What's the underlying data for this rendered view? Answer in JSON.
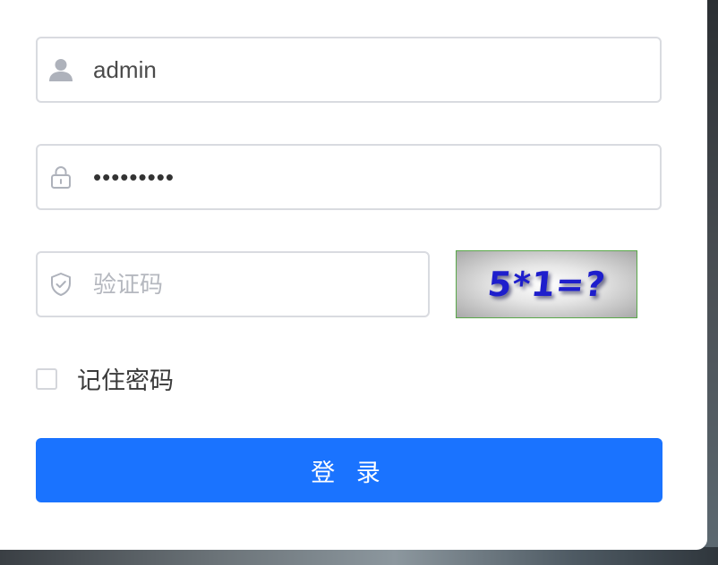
{
  "login": {
    "username": {
      "value": "admin",
      "icon": "user-icon"
    },
    "password": {
      "value": "admin1234",
      "icon": "lock-icon"
    },
    "captcha": {
      "placeholder": "验证码",
      "value": "",
      "icon": "shield-icon",
      "image_text": "5*1=?"
    },
    "remember_label": "记住密码",
    "remember_checked": false,
    "submit_label": "登 录"
  },
  "colors": {
    "primary": "#1a73ff",
    "border": "#d9dbe0",
    "icon": "#aeb2bb",
    "captcha_text": "#1e1ecc",
    "captcha_border": "#5aa84a"
  }
}
